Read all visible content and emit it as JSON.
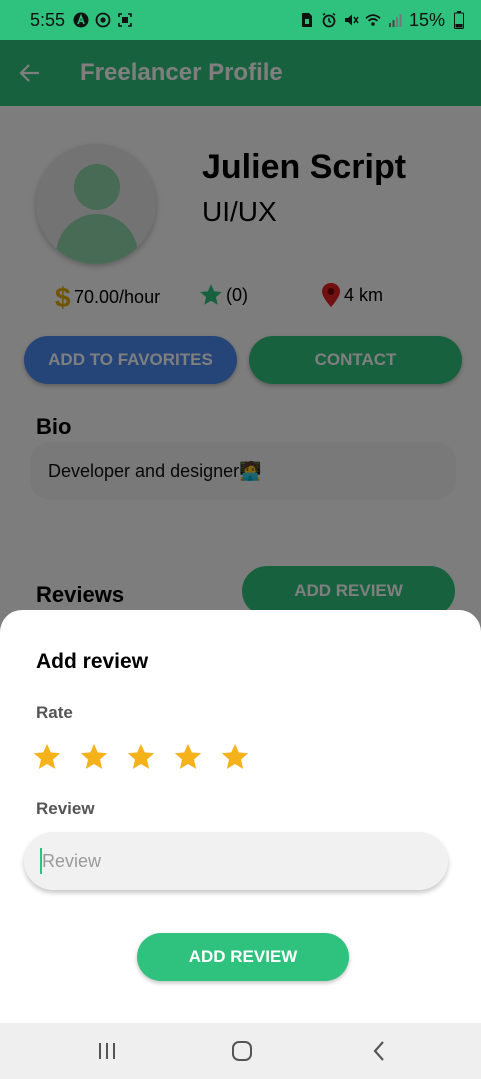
{
  "status_bar": {
    "time": "5:55",
    "battery": "15%",
    "left_icons": [
      "a-circle-icon",
      "whatsapp-icon",
      "screenshot-icon"
    ],
    "right_icons": [
      "sim-icon",
      "alarm-icon",
      "mute-icon",
      "wifi-icon",
      "signal-icon",
      "battery-icon"
    ]
  },
  "app_bar": {
    "title": "Freelancer Profile"
  },
  "profile": {
    "name": "Julien Script",
    "role": "UI/UX",
    "rate": "70.00/hour",
    "rating": "(0)",
    "distance": "4 km"
  },
  "actions": {
    "favorites_label": "ADD TO FAVORITES",
    "contact_label": "CONTACT"
  },
  "bio": {
    "heading": "Bio",
    "text": "Developer and designer🧑‍💻"
  },
  "reviews": {
    "heading": "Reviews",
    "add_button": "ADD REVIEW"
  },
  "sheet": {
    "title": "Add review",
    "rate_label": "Rate",
    "stars": 5,
    "review_label": "Review",
    "review_placeholder": "Review",
    "submit_label": "ADD REVIEW"
  },
  "colors": {
    "primary": "#2ec27e",
    "favorites": "#4a88ee",
    "star": "#f6b21a",
    "dollar": "#e0a800",
    "pin": "#e02020"
  }
}
